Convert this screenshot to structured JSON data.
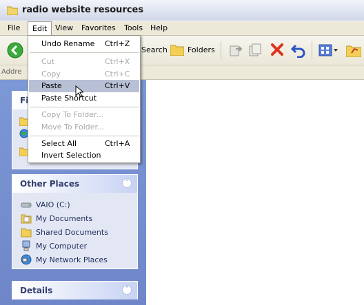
{
  "window": {
    "title": "radio website resources"
  },
  "menubar": {
    "items": [
      "File",
      "Edit",
      "View",
      "Favorites",
      "Tools",
      "Help"
    ]
  },
  "toolbar": {
    "search_label": "Search",
    "folders_label": "Folders"
  },
  "addressbar": {
    "label": "Addre"
  },
  "edit_menu": {
    "items": [
      {
        "label": "Undo Rename",
        "shortcut": "Ctrl+Z",
        "enabled": true
      },
      {
        "label": "Cut",
        "shortcut": "Ctrl+X",
        "enabled": false
      },
      {
        "label": "Copy",
        "shortcut": "Ctrl+C",
        "enabled": false
      },
      {
        "label": "Paste",
        "shortcut": "Ctrl+V",
        "enabled": true,
        "highlighted": true
      },
      {
        "label": "Paste Shortcut",
        "shortcut": "",
        "enabled": true
      },
      {
        "label": "Copy To Folder...",
        "shortcut": "",
        "enabled": false
      },
      {
        "label": "Move To Folder...",
        "shortcut": "",
        "enabled": false
      },
      {
        "label": "Select All",
        "shortcut": "Ctrl+A",
        "enabled": true
      },
      {
        "label": "Invert Selection",
        "shortcut": "",
        "enabled": true
      }
    ]
  },
  "file_tasks_panel": {
    "title_fragment": "Fi"
  },
  "other_places": {
    "title": "Other Places",
    "items": [
      {
        "label": "VAIO (C:)",
        "icon": "drive-icon"
      },
      {
        "label": "My Documents",
        "icon": "my-documents-icon"
      },
      {
        "label": "Shared Documents",
        "icon": "shared-folder-icon"
      },
      {
        "label": "My Computer",
        "icon": "my-computer-icon"
      },
      {
        "label": "My Network Places",
        "icon": "network-places-icon"
      }
    ]
  },
  "details": {
    "title": "Details"
  },
  "colors": {
    "taskpane": "#7c98d6",
    "panel_title": "#215dc6",
    "menu_highlight": "#b8c0d6",
    "close_red": "#e0301e"
  }
}
